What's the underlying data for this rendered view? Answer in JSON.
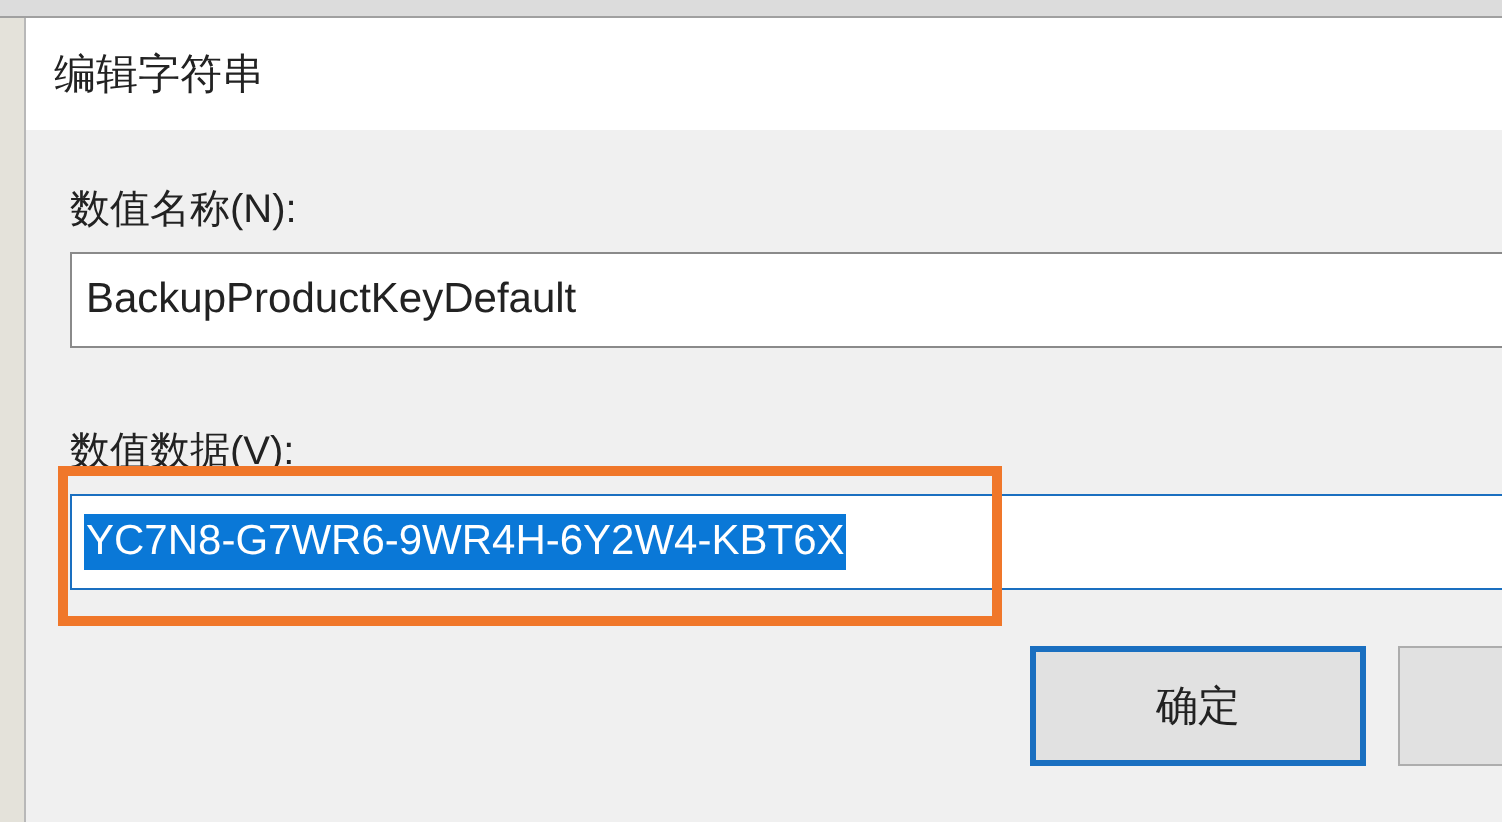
{
  "window": {
    "title": "编辑字符串"
  },
  "fields": [
    {
      "label": "数值名称(N):",
      "value": "BackupProductKeyDefault",
      "selected": false
    },
    {
      "label": "数值数据(V):",
      "value": "YC7N8-G7WR6-9WR4H-6Y2W4-KBT6X",
      "selected": true,
      "highlighted": true
    }
  ],
  "buttons": [
    {
      "label": "确定",
      "focused": true
    },
    {
      "focused": false
    }
  ]
}
